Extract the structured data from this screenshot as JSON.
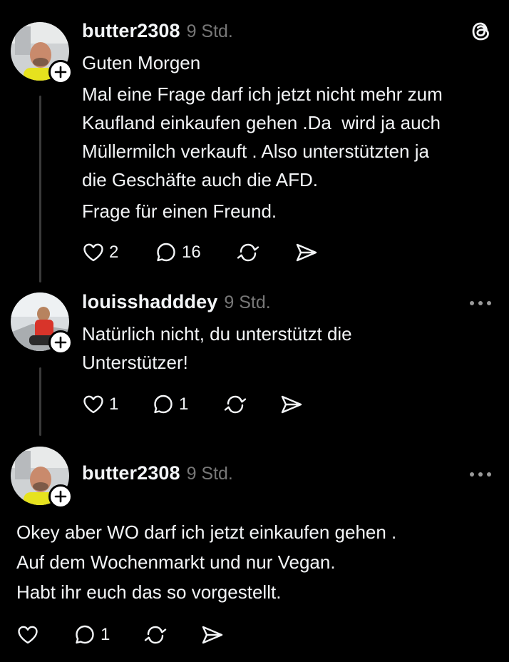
{
  "colors": {
    "background": "#000000",
    "text": "#f3f5f7",
    "muted": "#777777",
    "thread_line": "#3a3a3a"
  },
  "posts": [
    {
      "username": "butter2308",
      "timestamp": "9 Std.",
      "corner_icon": "threads-logo-icon",
      "paragraphs": [
        "Guten Morgen",
        "Mal eine Frage darf ich jetzt nicht mehr zum\nKaufland einkaufen gehen .Da  wird ja auch\nMüllermilch verkauft . Also unterstützten ja\ndie Geschäfte auch die AFD.",
        "Frage für einen Freund."
      ],
      "likes": "2",
      "replies": "16",
      "reposts": "",
      "shares": ""
    },
    {
      "username": "louisshadddey",
      "timestamp": "9 Std.",
      "corner_icon": "more-options-icon",
      "paragraphs": [
        "Natürlich nicht, du unterstützt die\nUnterstützer!"
      ],
      "likes": "1",
      "replies": "1",
      "reposts": "",
      "shares": ""
    },
    {
      "username": "butter2308",
      "timestamp": "9 Std.",
      "corner_icon": "more-options-icon",
      "paragraphs": [
        "Okey aber WO darf ich jetzt einkaufen gehen .",
        "Auf dem Wochenmarkt und nur Vegan.",
        "Habt ihr euch das so vorgestellt."
      ],
      "likes": "",
      "replies": "1",
      "reposts": "",
      "shares": ""
    }
  ]
}
